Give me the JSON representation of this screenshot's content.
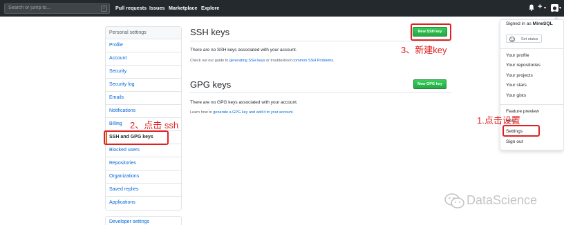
{
  "header": {
    "search_placeholder": "Search or jump to...",
    "slash_key": "/",
    "nav": [
      "Pull requests",
      "Issues",
      "Marketplace",
      "Explore"
    ],
    "plus": "+",
    "caret": "▾"
  },
  "sidebar": {
    "title": "Personal settings",
    "items": [
      "Profile",
      "Account",
      "Security",
      "Security log",
      "Emails",
      "Notifications",
      "Billing",
      "SSH and GPG keys",
      "Blocked users",
      "Repositories",
      "Organizations",
      "Saved replies",
      "Applications"
    ],
    "developer": "Developer settings"
  },
  "ssh": {
    "title": "SSH keys",
    "button": "New SSH key",
    "empty": "There are no SSH keys associated with your account.",
    "note_pre": "Check out our guide to ",
    "note_link1": "generating SSH keys",
    "note_mid": " or troubleshoot ",
    "note_link2": "common SSH Problems",
    "note_post": "."
  },
  "gpg": {
    "title": "GPG keys",
    "button": "New GPG key",
    "empty": "There are no GPG keys associated with your account.",
    "note_pre": "Learn how to ",
    "note_link": "generate a GPG key and add it to your account",
    "note_post": "."
  },
  "dropdown": {
    "signed_in_as": "Signed in as",
    "username": "MineSQL",
    "set_status": "Set status",
    "links": [
      "Your profile",
      "Your repositories",
      "Your projects",
      "Your stars",
      "Your gists"
    ],
    "feature_preview": "Feature preview",
    "help": "Help",
    "settings": "Settings",
    "sign_out": "Sign out"
  },
  "annotations": {
    "step1": "1.点击设置",
    "step2": "2、点击 ssh",
    "step3": "3、新建key"
  },
  "watermark": "DataScience",
  "colors": {
    "header_bg": "#24292e",
    "link": "#0366d6",
    "button_green": "#28a745",
    "annotation_red": "#e02020",
    "selected_accent": "#e36209"
  }
}
